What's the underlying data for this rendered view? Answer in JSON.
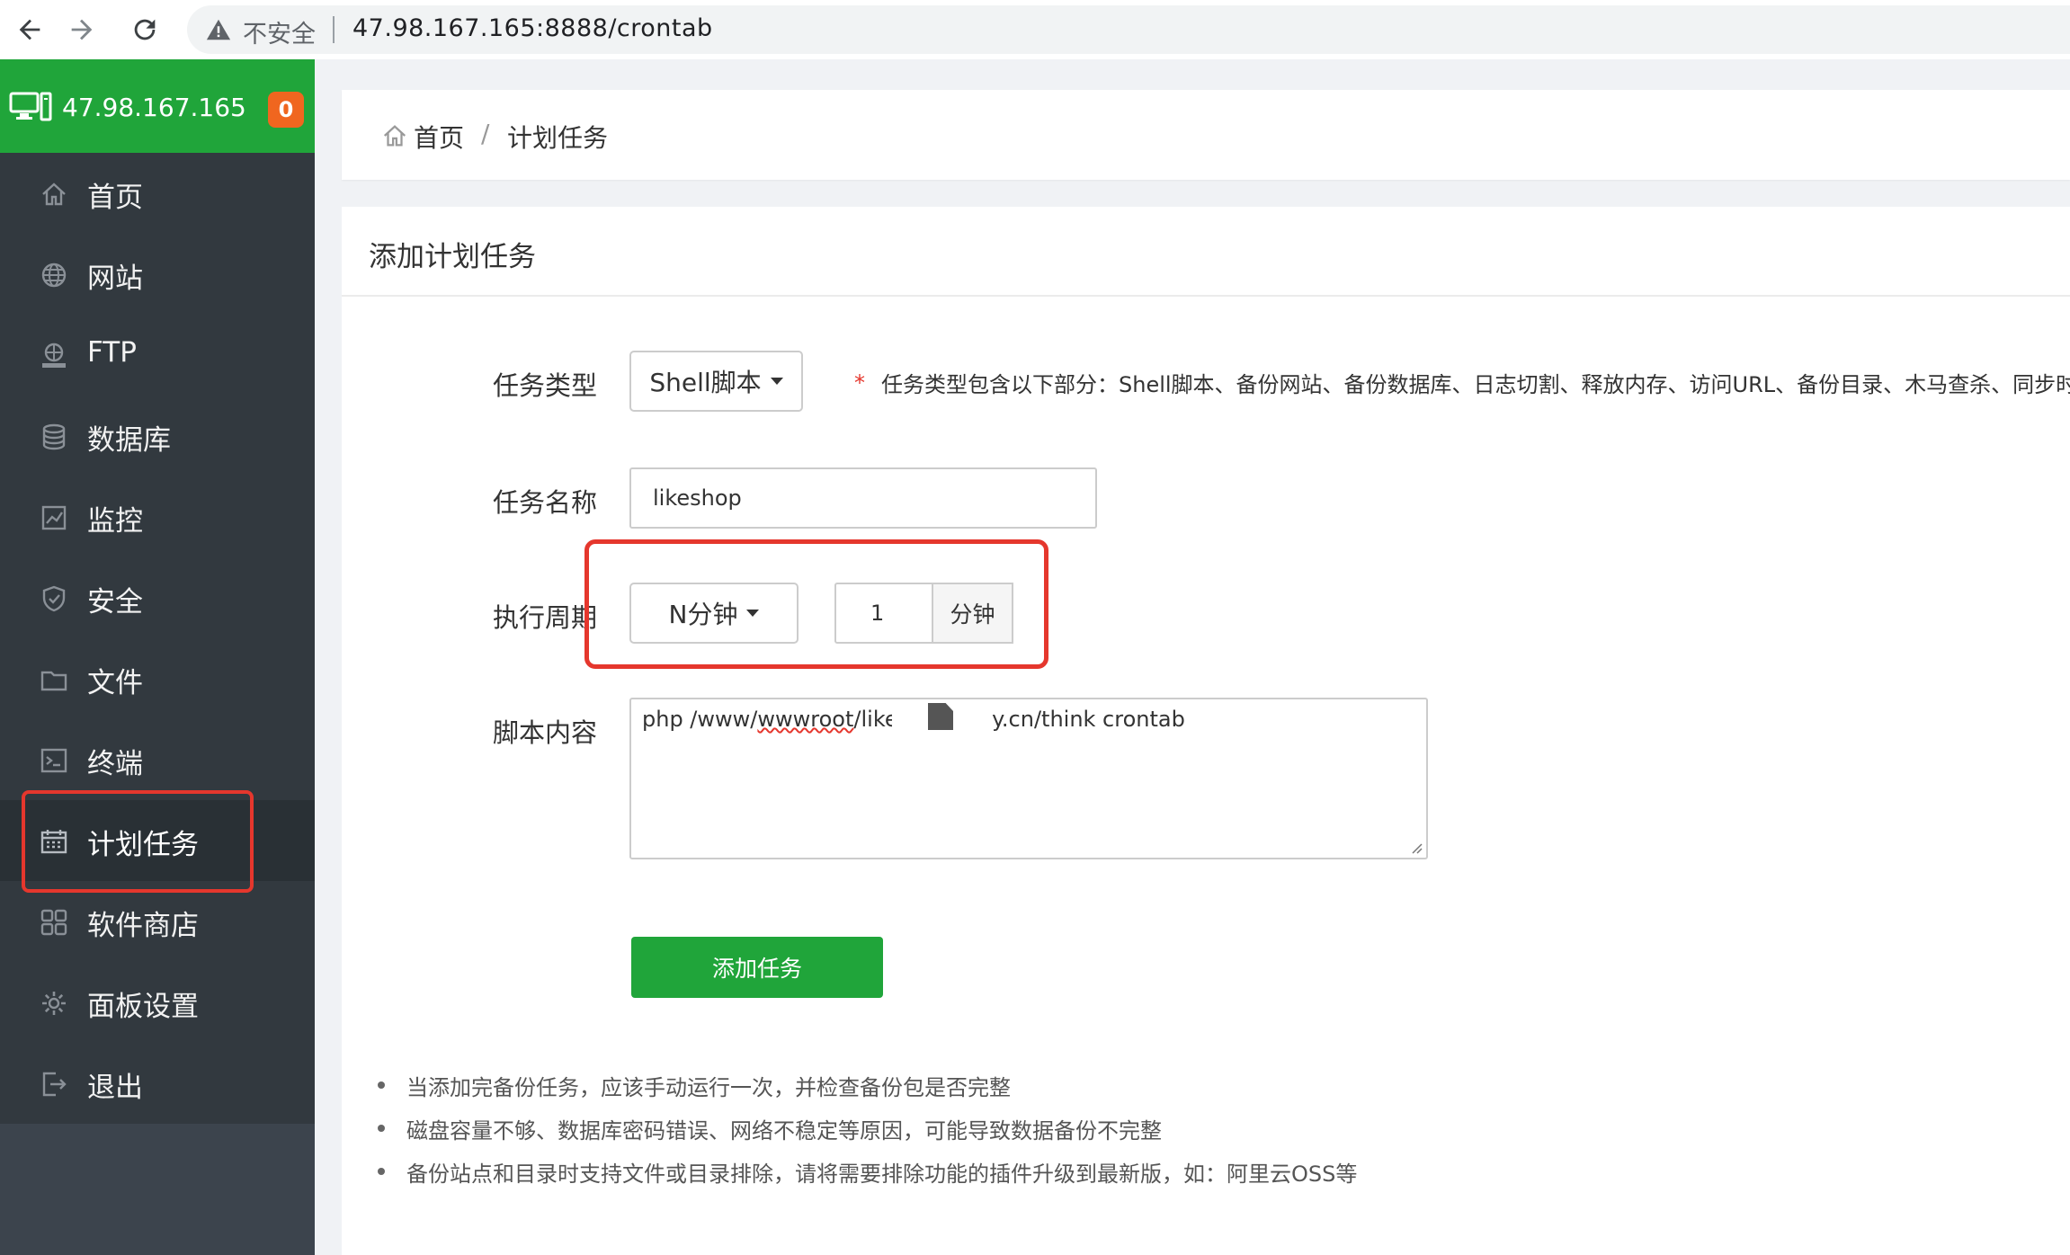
{
  "browser": {
    "insecure_label": "不安全",
    "url": "47.98.167.165:8888/crontab"
  },
  "sidebar": {
    "server_ip": "47.98.167.165",
    "badge_count": "0",
    "items": [
      {
        "label": "首页",
        "icon": "home-icon"
      },
      {
        "label": "网站",
        "icon": "globe-icon"
      },
      {
        "label": "FTP",
        "icon": "ftp-icon"
      },
      {
        "label": "数据库",
        "icon": "database-icon"
      },
      {
        "label": "监控",
        "icon": "monitor-chart-icon"
      },
      {
        "label": "安全",
        "icon": "shield-icon"
      },
      {
        "label": "文件",
        "icon": "folder-icon"
      },
      {
        "label": "终端",
        "icon": "terminal-icon"
      },
      {
        "label": "计划任务",
        "icon": "calendar-icon",
        "active": true
      },
      {
        "label": "软件商店",
        "icon": "apps-grid-icon"
      },
      {
        "label": "面板设置",
        "icon": "gear-icon"
      },
      {
        "label": "退出",
        "icon": "logout-icon"
      }
    ]
  },
  "breadcrumb": {
    "home": "首页",
    "separator": "/",
    "current": "计划任务"
  },
  "form": {
    "title": "添加计划任务",
    "task_type_label": "任务类型",
    "task_type_value": "Shell脚本",
    "task_type_hint_star": "*",
    "task_type_hint": "任务类型包含以下部分：Shell脚本、备份网站、备份数据库、日志切割、释放内存、访问URL、备份目录、木马查杀、同步时",
    "task_name_label": "任务名称",
    "task_name_value": "likeshop",
    "period_label": "执行周期",
    "period_type_value": "N分钟",
    "period_number_value": "1",
    "period_unit": "分钟",
    "script_label": "脚本内容",
    "script_prefix": "php /www/",
    "script_squiggle": "wwwroot",
    "script_middle": "/likes",
    "script_suffix": "y.cn/think crontab",
    "submit_label": "添加任务"
  },
  "tips": [
    "当添加完备份任务，应该手动运行一次，并检查备份包是否完整",
    "磁盘容量不够、数据库密码错误、网络不稳定等原因，可能导致数据备份不完整",
    "备份站点和目录时支持文件或目录排除，请将需要排除功能的插件升级到最新版，如：阿里云OSS等"
  ],
  "colors": {
    "brand_green": "#20a53a",
    "sidebar_bg": "#32393f",
    "highlight_red": "#e5372d",
    "badge_orange": "#f0661f"
  }
}
